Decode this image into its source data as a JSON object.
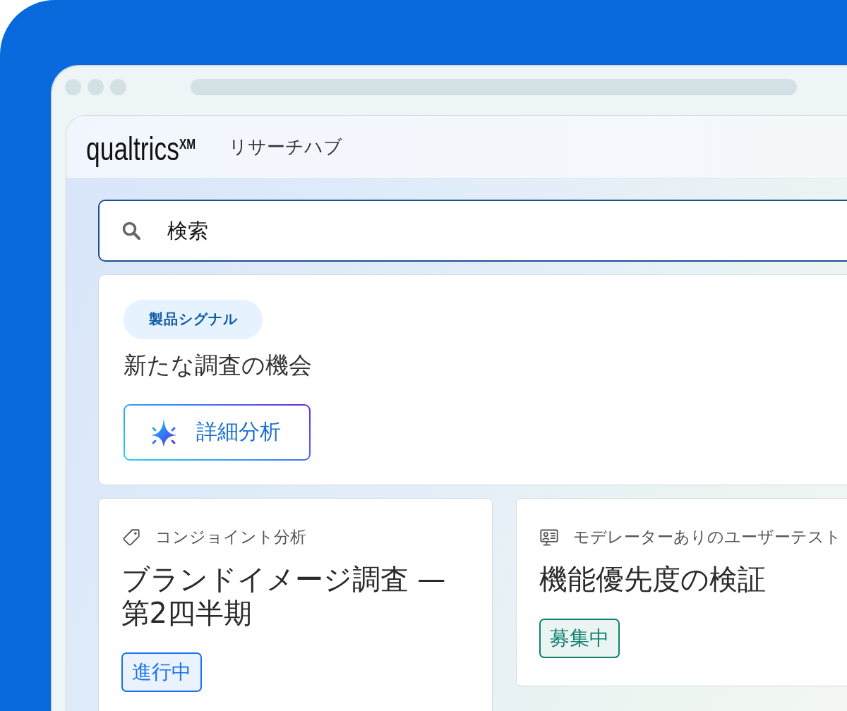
{
  "header": {
    "logo": "qualtrics$^{XM}$",
    "title": "リサーチハブ"
  },
  "search": {
    "placeholder": "検索"
  },
  "signal": {
    "badge": "製品シグナル",
    "title": "新たな調査の機会",
    "button": "詳細分析"
  },
  "studies": [
    {
      "kind": "conjoint",
      "method": "コンジョイント分析",
      "title": "ブランドイメージ調査 — 第2四半期",
      "status": {
        "label": "進行中",
        "color": "#1a73e8"
      }
    },
    {
      "kind": "moderated",
      "method": "モデレーターありのユーザーテスト",
      "title": "機能優先度の検証",
      "status": {
        "label": "募集中",
        "color": "#12806e"
      }
    }
  ]
}
